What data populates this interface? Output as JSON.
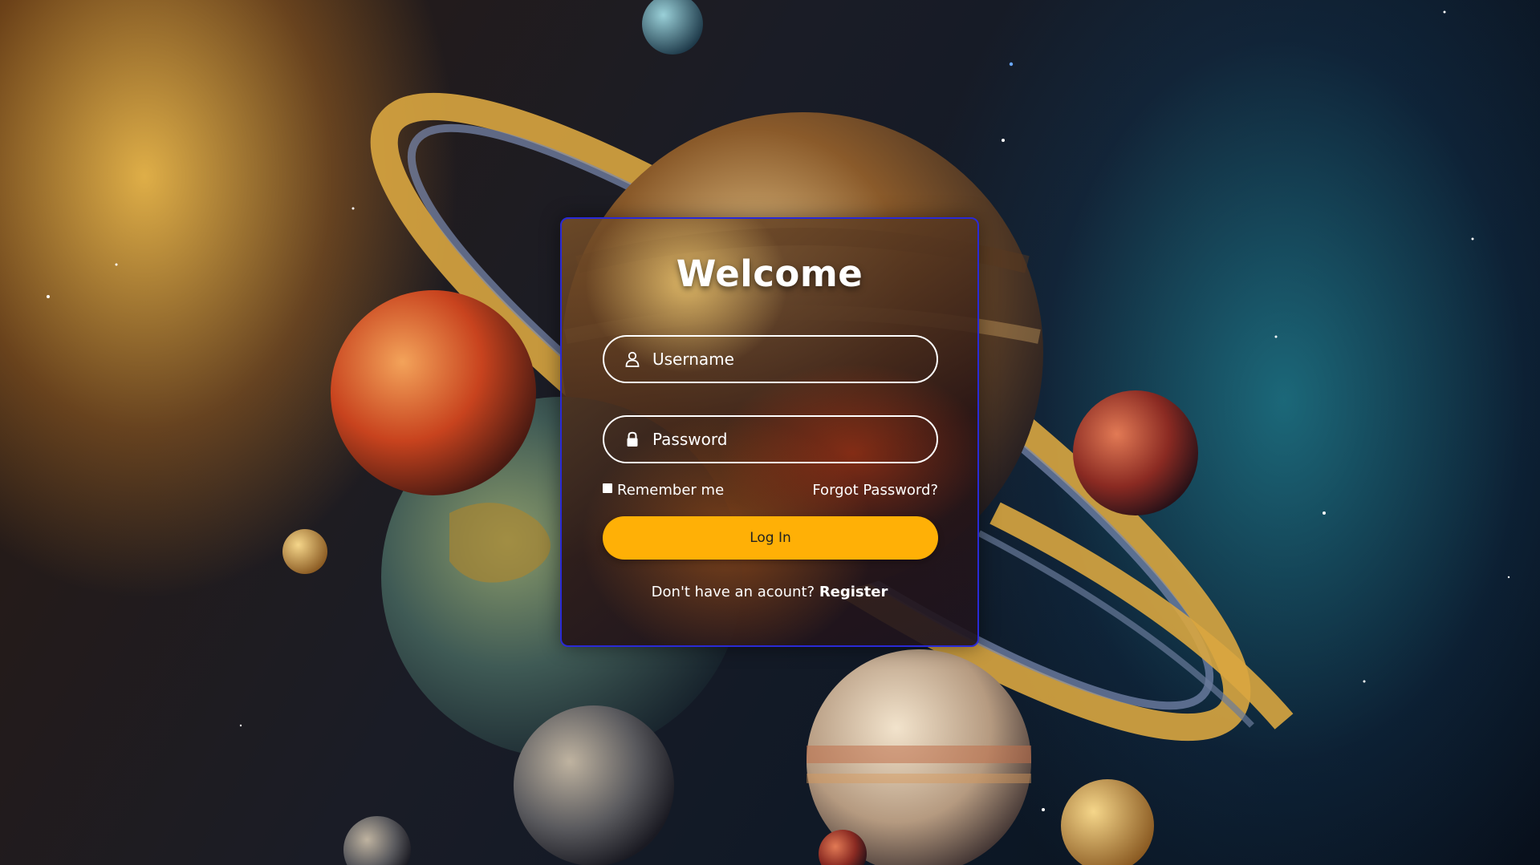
{
  "login": {
    "title": "Welcome",
    "username_placeholder": "Username",
    "password_placeholder": "Password",
    "remember_label": "Remember me",
    "forgot_label": "Forgot Password?",
    "login_button": "Log In",
    "register_prompt": "Don't have an acount?",
    "register_link": "Register"
  },
  "icons": {
    "username": "user-icon",
    "password": "lock-icon"
  },
  "colors": {
    "accent_button": "#ffb006",
    "card_border": "#2a2ad6",
    "text": "#ffffff"
  }
}
